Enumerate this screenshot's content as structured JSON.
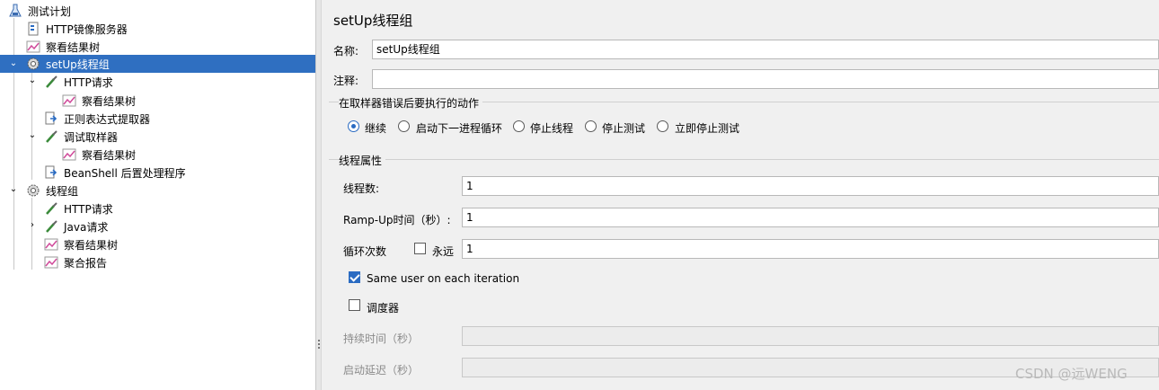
{
  "tree": {
    "items": [
      {
        "label": "测试计划",
        "icon": "test-plan-icon",
        "expanded": true
      },
      {
        "label": "HTTP镜像服务器",
        "icon": "http-mirror-server-icon"
      },
      {
        "label": "察看结果树",
        "icon": "results-tree-listener-icon"
      },
      {
        "label": "setUp线程组",
        "icon": "gear-icon",
        "expanded": true,
        "selected": true
      },
      {
        "label": "HTTP请求",
        "icon": "pipette-sampler-icon",
        "expanded": true
      },
      {
        "label": "察看结果树",
        "icon": "results-tree-listener-icon"
      },
      {
        "label": "正则表达式提取器",
        "icon": "extractor-arrow-icon"
      },
      {
        "label": "调试取样器",
        "icon": "pipette-sampler-icon",
        "expanded": true
      },
      {
        "label": "察看结果树",
        "icon": "results-tree-listener-icon"
      },
      {
        "label": "BeanShell 后置处理程序",
        "icon": "extractor-arrow-icon"
      },
      {
        "label": "线程组",
        "icon": "gear-icon",
        "expanded": true
      },
      {
        "label": "HTTP请求",
        "icon": "pipette-sampler-icon"
      },
      {
        "label": "Java请求",
        "icon": "pipette-sampler-icon",
        "expanded": false
      },
      {
        "label": "察看结果树",
        "icon": "results-tree-listener-icon"
      },
      {
        "label": "聚合报告",
        "icon": "aggregate-report-icon"
      }
    ]
  },
  "panel": {
    "title": "setUp线程组",
    "name_label": "名称:",
    "name_value": "setUp线程组",
    "comment_label": "注释:",
    "comment_value": "",
    "error_action": {
      "title": "在取样器错误后要执行的动作",
      "options": [
        "继续",
        "启动下一进程循环",
        "停止线程",
        "停止测试",
        "立即停止测试"
      ],
      "selected": "继续"
    },
    "thread_props": {
      "title": "线程属性",
      "threads_label": "线程数:",
      "threads_value": "1",
      "rampup_label": "Ramp-Up时间（秒）:",
      "rampup_value": "1",
      "loop_label": "循环次数",
      "forever_label": "永远",
      "forever_checked": false,
      "loop_value": "1",
      "same_user_label": "Same user on each iteration",
      "same_user_checked": true,
      "scheduler_label": "调度器",
      "scheduler_checked": false,
      "duration_label": "持续时间（秒）",
      "duration_value": "",
      "delay_label": "启动延迟（秒）",
      "delay_value": ""
    }
  },
  "watermark": "CSDN @远WENG",
  "colors": {
    "selection": "#2f6fc1",
    "accent": "#2a6bc2",
    "panel_bg": "#f0f0f0"
  }
}
